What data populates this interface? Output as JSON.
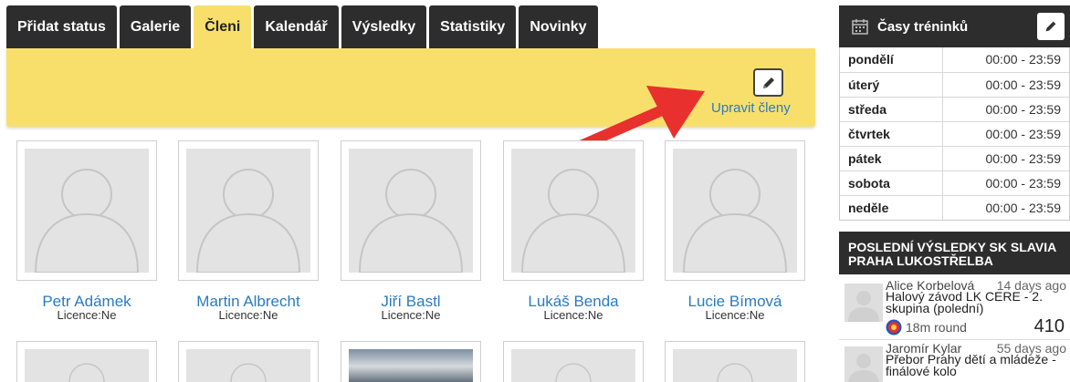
{
  "tabs": [
    {
      "label": "Přidat status"
    },
    {
      "label": "Galerie"
    },
    {
      "label": "Členi"
    },
    {
      "label": "Kalendář"
    },
    {
      "label": "Výsledky"
    },
    {
      "label": "Statistiky"
    },
    {
      "label": "Novinky"
    }
  ],
  "active_tab": "Členi",
  "toolbar": {
    "edit_members_label": "Upravit členy"
  },
  "members": [
    {
      "name": "Petr Adámek",
      "licence": "Licence:Ne"
    },
    {
      "name": "Martin Albrecht",
      "licence": "Licence:Ne"
    },
    {
      "name": "Jiří Bastl",
      "licence": "Licence:Ne"
    },
    {
      "name": "Lukáš Benda",
      "licence": "Licence:Ne"
    },
    {
      "name": "Lucie Bímová",
      "licence": "Licence:Ne"
    }
  ],
  "training": {
    "title": "Časy tréninků",
    "rows": [
      {
        "day": "pondělí",
        "time": "00:00 - 23:59"
      },
      {
        "day": "úterý",
        "time": "00:00 - 23:59"
      },
      {
        "day": "středa",
        "time": "00:00 - 23:59"
      },
      {
        "day": "čtvrtek",
        "time": "00:00 - 23:59"
      },
      {
        "day": "pátek",
        "time": "00:00 - 23:59"
      },
      {
        "day": "sobota",
        "time": "00:00 - 23:59"
      },
      {
        "day": "neděle",
        "time": "00:00 - 23:59"
      }
    ]
  },
  "results": {
    "title": "Poslední výsledky SK SLAVIA PRAHA LUKOSTŘELBA",
    "items": [
      {
        "author": "Alice Korbelová",
        "ago": "14 days ago",
        "event": "Halový závod LK CERE - 2. skupina (polední)",
        "round": "18m round",
        "score": "410"
      },
      {
        "author": "Jaromír Kylar",
        "ago": "55 days ago",
        "event": "Přebor Prahy dětí a mládeže - finálové kolo",
        "round": "",
        "score": ""
      }
    ]
  },
  "colors": {
    "accent_yellow": "#f8df6b",
    "tab_dark": "#2d2d2d",
    "link_blue": "#2b7bc2",
    "arrow_red": "#e8302f"
  }
}
